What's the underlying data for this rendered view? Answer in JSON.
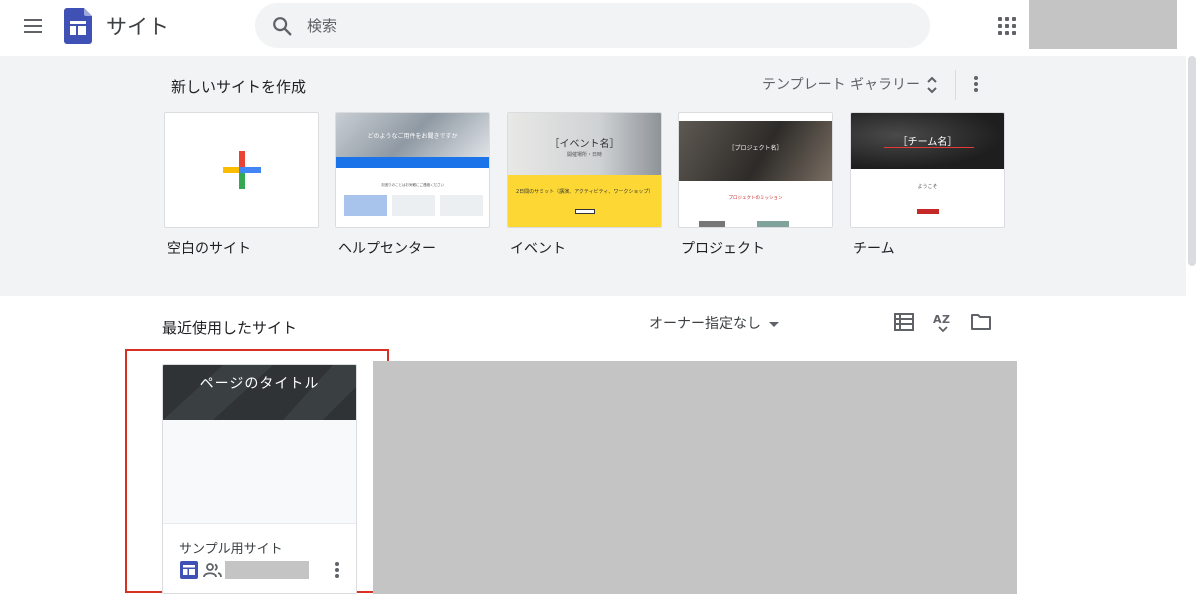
{
  "header": {
    "app_title": "サイト",
    "search_placeholder": "検索"
  },
  "gallery": {
    "title": "新しいサイトを作成",
    "toggle_label": "テンプレート ギャラリー",
    "templates": [
      {
        "label": "空白のサイト"
      },
      {
        "label": "ヘルプセンター",
        "thumb_title": "どのようなご用件をお聞きですか",
        "thumb_text": "お困りのことはお気軽にご連絡ください"
      },
      {
        "label": "イベント",
        "thumb_title": "［イベント名］",
        "thumb_subtitle": "開催場所・日時",
        "thumb_banner": "2日間のサミット（講演、アクティビティ、ワークショップ）"
      },
      {
        "label": "プロジェクト",
        "thumb_title": "［プロジェクト名］",
        "thumb_subtitle": "プロジェクトのミッション"
      },
      {
        "label": "チーム",
        "thumb_title": "［チーム名］",
        "thumb_subtitle": "ようこそ"
      }
    ]
  },
  "recent": {
    "title": "最近使用したサイト",
    "owner_filter": "オーナー指定なし",
    "sites": [
      {
        "header_title": "ページのタイトル",
        "name": "サンプル用サイト"
      }
    ]
  },
  "colors": {
    "accent_blue": "#4285f4",
    "accent_red": "#ea4335",
    "accent_yellow": "#fbbc04",
    "accent_green": "#34a853",
    "sites_brand": "#3f51b5",
    "highlight": "#d93025"
  }
}
